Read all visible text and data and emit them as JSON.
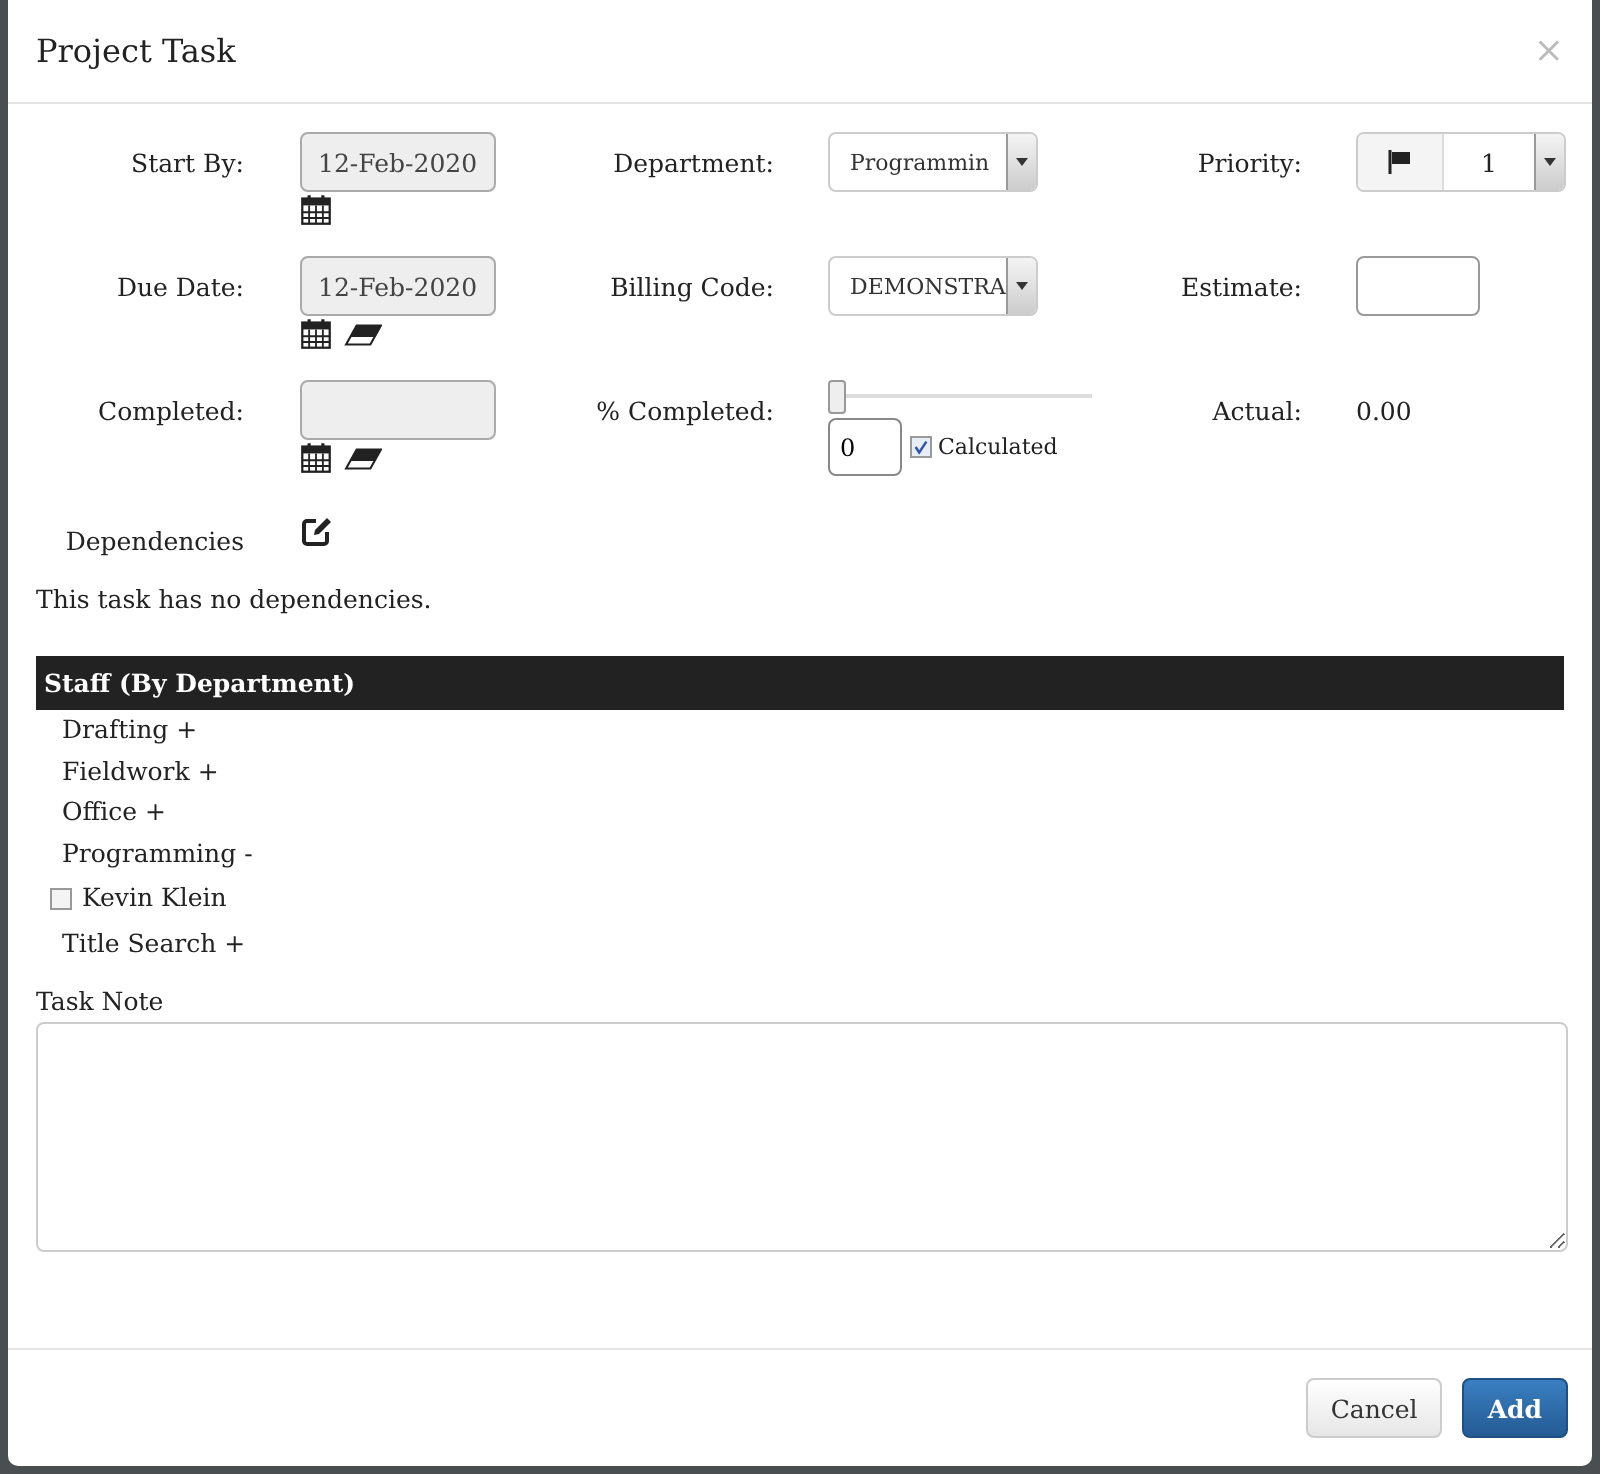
{
  "dialog": {
    "title": "Project Task",
    "close": "×"
  },
  "fields": {
    "start_by": {
      "label": "Start By:",
      "value": "12-Feb-2020"
    },
    "due_date": {
      "label": "Due Date:",
      "value": "12-Feb-2020"
    },
    "completed": {
      "label": "Completed:"
    },
    "department": {
      "label": "Department:",
      "value": "Programmin"
    },
    "billing_code": {
      "label": "Billing Code:",
      "value": "DEMONSTRA"
    },
    "percent_completed": {
      "label": "% Completed:",
      "level": 0,
      "value": "0",
      "calculated": {
        "label": "Calculated",
        "checked": true
      }
    },
    "priority": {
      "label": "Priority:",
      "value": "1"
    },
    "estimate": {
      "label": "Estimate:"
    },
    "actual": {
      "label": "Actual:",
      "value": "0.00"
    }
  },
  "dependencies": {
    "label": "Dependencies",
    "message": "This task has no dependencies."
  },
  "staff": {
    "title": "Staff (By Department)",
    "departments": [
      {
        "name": "Drafting",
        "toggle": "+"
      },
      {
        "name": "Fieldwork",
        "toggle": "+"
      },
      {
        "name": "Office",
        "toggle": "+"
      },
      {
        "name": "Programming",
        "toggle": "-",
        "children": [
          {
            "name": "Kevin Klein",
            "checked": false
          }
        ]
      },
      {
        "name": "Title Search",
        "toggle": "+"
      }
    ]
  },
  "task_note": {
    "label": "Task Note"
  },
  "buttons": [
    {
      "label": "Cancel",
      "kind": "default"
    },
    {
      "label": "Add",
      "kind": "primary"
    }
  ]
}
